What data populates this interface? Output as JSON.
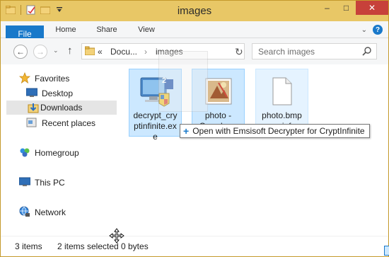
{
  "window": {
    "title": "images"
  },
  "quick_access": {
    "icons": [
      "folder-icon",
      "properties-icon",
      "new-folder-icon",
      "customize-dropdown-icon"
    ]
  },
  "window_controls": {
    "minimize": "–",
    "maximize": "□",
    "close": "✕"
  },
  "ribbon": {
    "tabs": [
      {
        "label": "File"
      },
      {
        "label": "Home"
      },
      {
        "label": "Share"
      },
      {
        "label": "View"
      }
    ],
    "expand_glyph": "⌄",
    "help_glyph": "?"
  },
  "navigation": {
    "back_glyph": "←",
    "forward_glyph": "→",
    "recent_glyph": "⌄",
    "up_glyph": "↑",
    "address": {
      "prefix": "«",
      "parent": "Docu...",
      "separator": "›",
      "current": "images",
      "dropdown": "⌄"
    },
    "refresh_glyph": "↻",
    "search_placeholder": "Search images"
  },
  "nav_pane": {
    "favorites": "Favorites",
    "desktop": "Desktop",
    "downloads": "Downloads",
    "recent_places": "Recent places",
    "homegroup": "Homegroup",
    "this_pc": "This PC",
    "network": "Network"
  },
  "files": [
    {
      "name": "decrypt_cryptinfinite.exe",
      "name_lines": [
        "decrypt_cry",
        "ptinfinite.ex",
        "e"
      ],
      "icon": "executable-icon",
      "badge": "2",
      "state": "selected"
    },
    {
      "name": "photo - Copy.bmp",
      "name_lines": [
        "photo -",
        "Copy.bmp"
      ],
      "icon": "bitmap-image-icon",
      "state": "selected"
    },
    {
      "name": "photo.bmp.crinf",
      "name_lines": [
        "photo.bmp",
        ".crinf"
      ],
      "icon": "blank-document-icon",
      "state": "selected"
    }
  ],
  "drag_tooltip": {
    "text": "Open with Emsisoft Decrypter for CryptInfinite",
    "glyph": "+"
  },
  "status": {
    "item_count": "3 items",
    "selection": "2 items selected",
    "size": "0 bytes"
  },
  "colors": {
    "title_bar": "#e8c766",
    "file_tab": "#1979ca",
    "selection": "#cce8ff",
    "close_button": "#c7413a"
  }
}
